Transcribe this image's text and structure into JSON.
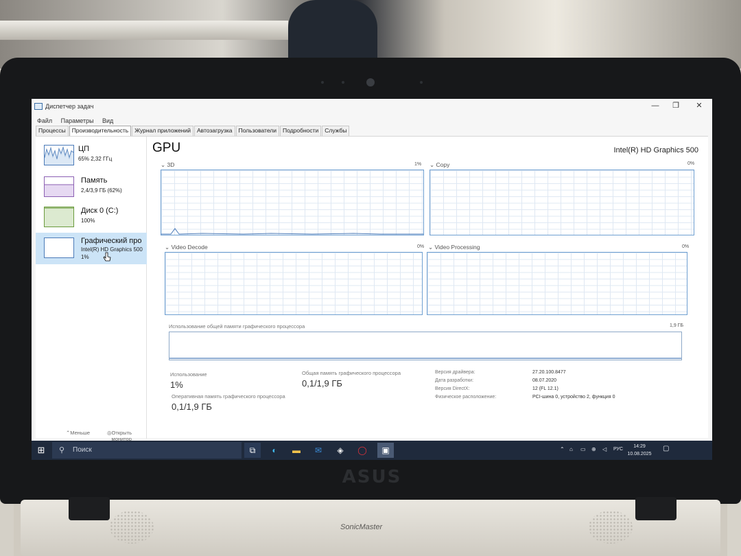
{
  "window": {
    "title": "Диспетчер задач",
    "min_glyph": "—",
    "max_glyph": "❐",
    "close_glyph": "✕"
  },
  "menu": [
    "Файл",
    "Параметры",
    "Вид"
  ],
  "tabs": [
    "Процессы",
    "Производительность",
    "Журнал приложений",
    "Автозагрузка",
    "Пользователи",
    "Подробности",
    "Службы"
  ],
  "sidebar": {
    "items": [
      {
        "name": "ЦП",
        "sub1": "65% 2,32 ГГц",
        "sub2": ""
      },
      {
        "name": "Память",
        "sub1": "2,4/3,9 ГБ (62%)",
        "sub2": ""
      },
      {
        "name": "Диск 0 (C:)",
        "sub1": "100%",
        "sub2": ""
      },
      {
        "name": "Графический про",
        "sub1": "Intel(R) HD Graphics 500",
        "sub2": "1%"
      }
    ]
  },
  "gpu": {
    "title": "GPU",
    "model": "Intel(R) HD Graphics 500",
    "graphs": [
      {
        "label": "3D",
        "percent": "1%"
      },
      {
        "label": "Copy",
        "percent": "0%"
      },
      {
        "label": "Video Decode",
        "percent": "0%"
      },
      {
        "label": "Video Processing",
        "percent": "0%"
      }
    ],
    "shared_memory": {
      "label": "Использование общей памяти графического процессора",
      "value": "1,9 ГБ"
    },
    "stats": {
      "usage_label": "Использование",
      "usage_value": "1%",
      "dedicated_label": "Оперативная память графического процессора",
      "dedicated_value": "0,1/1,9 ГБ",
      "shared_label": "Общая память графического процессора",
      "shared_value": "0,1/1,9 ГБ"
    },
    "info": [
      {
        "key": "Версия драйвера:",
        "value": "27.20.100.8477"
      },
      {
        "key": "Дата разработки:",
        "value": "08.07.2020"
      },
      {
        "key": "Версия DirectX:",
        "value": "12 (FL 12.1)"
      },
      {
        "key": "Физическое расположение:",
        "value": "PCI-шина 0, устройство 2, функция 0"
      }
    ]
  },
  "footer": {
    "less_label": "Меньше",
    "monitor_label": "Открыть монитор ресурсов"
  },
  "taskbar": {
    "search_placeholder": "Поиск",
    "language": "РУС",
    "time": "14:29",
    "date": "10.08.2025"
  },
  "hardware": {
    "brand": "ASUS",
    "sound_label": "SonicMaster"
  },
  "colors": {
    "graph_border": "#6e9fd1",
    "graph_line": "#4a7ab8",
    "selected_sidebar": "#cce4f7",
    "taskbar": "#1f2a3c"
  }
}
